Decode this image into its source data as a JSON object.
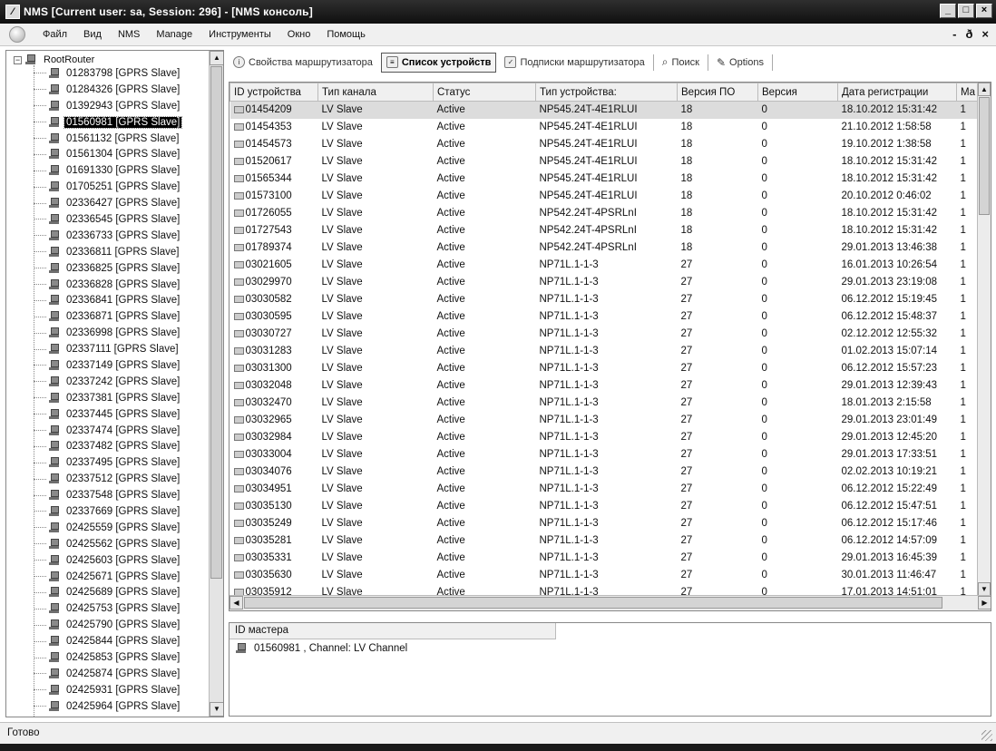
{
  "window": {
    "title": "NMS [Current user: sa, Session: 296] - [NMS консоль]",
    "app_icon": "nms-app-icon"
  },
  "menu": {
    "items": [
      "Файл",
      "Вид",
      "NMS",
      "Manage",
      "Инструменты",
      "Окно",
      "Помощь"
    ],
    "mdi_controls": [
      "-",
      "ð",
      "×"
    ]
  },
  "tree": {
    "root": "RootRouter",
    "items": [
      "01283798 [GPRS Slave]",
      "01284326 [GPRS Slave]",
      "01392943 [GPRS Slave]",
      "01560981 [GPRS Slave]",
      "01561132 [GPRS Slave]",
      "01561304 [GPRS Slave]",
      "01691330 [GPRS Slave]",
      "01705251 [GPRS Slave]",
      "02336427 [GPRS Slave]",
      "02336545 [GPRS Slave]",
      "02336733 [GPRS Slave]",
      "02336811 [GPRS Slave]",
      "02336825 [GPRS Slave]",
      "02336828 [GPRS Slave]",
      "02336841 [GPRS Slave]",
      "02336871 [GPRS Slave]",
      "02336998 [GPRS Slave]",
      "02337111 [GPRS Slave]",
      "02337149 [GPRS Slave]",
      "02337242 [GPRS Slave]",
      "02337381 [GPRS Slave]",
      "02337445 [GPRS Slave]",
      "02337474 [GPRS Slave]",
      "02337482 [GPRS Slave]",
      "02337495 [GPRS Slave]",
      "02337512 [GPRS Slave]",
      "02337548 [GPRS Slave]",
      "02337669 [GPRS Slave]",
      "02425559 [GPRS Slave]",
      "02425562 [GPRS Slave]",
      "02425603 [GPRS Slave]",
      "02425671 [GPRS Slave]",
      "02425689 [GPRS Slave]",
      "02425753 [GPRS Slave]",
      "02425790 [GPRS Slave]",
      "02425844 [GPRS Slave]",
      "02425853 [GPRS Slave]",
      "02425874 [GPRS Slave]",
      "02425931 [GPRS Slave]",
      "02425964 [GPRS Slave]"
    ],
    "selected_index": 3
  },
  "toolbar": {
    "tabs": [
      {
        "label": "Свойства маршрутизатора",
        "icon": "info-icon",
        "active": false
      },
      {
        "label": "Список устройств",
        "icon": "device-list-icon",
        "active": true
      },
      {
        "label": "Подписки маршрутизатора",
        "icon": "checkbox-icon",
        "active": false
      },
      {
        "label": "Поиск",
        "icon": "search-icon",
        "active": false
      },
      {
        "label": "Options",
        "icon": "pencil-icon",
        "active": false
      }
    ]
  },
  "grid": {
    "columns": [
      "ID устройства",
      "Тип канала",
      "Статус",
      "Тип устройства:",
      "Версия ПО",
      "Версия",
      "Дата регистрации",
      "Ma"
    ],
    "selected_row": 0,
    "rows": [
      [
        "01454209",
        "LV Slave",
        "Active",
        "NP545.24T-4E1RLUI",
        "18",
        "0",
        "18.10.2012 15:31:42",
        "1"
      ],
      [
        "01454353",
        "LV Slave",
        "Active",
        "NP545.24T-4E1RLUI",
        "18",
        "0",
        "21.10.2012 1:58:58",
        "1"
      ],
      [
        "01454573",
        "LV Slave",
        "Active",
        "NP545.24T-4E1RLUI",
        "18",
        "0",
        "19.10.2012 1:38:58",
        "1"
      ],
      [
        "01520617",
        "LV Slave",
        "Active",
        "NP545.24T-4E1RLUI",
        "18",
        "0",
        "18.10.2012 15:31:42",
        "1"
      ],
      [
        "01565344",
        "LV Slave",
        "Active",
        "NP545.24T-4E1RLUI",
        "18",
        "0",
        "18.10.2012 15:31:42",
        "1"
      ],
      [
        "01573100",
        "LV Slave",
        "Active",
        "NP545.24T-4E1RLUI",
        "18",
        "0",
        "20.10.2012 0:46:02",
        "1"
      ],
      [
        "01726055",
        "LV Slave",
        "Active",
        "NP542.24T-4PSRLnI",
        "18",
        "0",
        "18.10.2012 15:31:42",
        "1"
      ],
      [
        "01727543",
        "LV Slave",
        "Active",
        "NP542.24T-4PSRLnI",
        "18",
        "0",
        "18.10.2012 15:31:42",
        "1"
      ],
      [
        "01789374",
        "LV Slave",
        "Active",
        "NP542.24T-4PSRLnI",
        "18",
        "0",
        "29.01.2013 13:46:38",
        "1"
      ],
      [
        "03021605",
        "LV Slave",
        "Active",
        "NP71L.1-1-3",
        "27",
        "0",
        "16.01.2013 10:26:54",
        "1"
      ],
      [
        "03029970",
        "LV Slave",
        "Active",
        "NP71L.1-1-3",
        "27",
        "0",
        "29.01.2013 23:19:08",
        "1"
      ],
      [
        "03030582",
        "LV Slave",
        "Active",
        "NP71L.1-1-3",
        "27",
        "0",
        "06.12.2012 15:19:45",
        "1"
      ],
      [
        "03030595",
        "LV Slave",
        "Active",
        "NP71L.1-1-3",
        "27",
        "0",
        "06.12.2012 15:48:37",
        "1"
      ],
      [
        "03030727",
        "LV Slave",
        "Active",
        "NP71L.1-1-3",
        "27",
        "0",
        "02.12.2012 12:55:32",
        "1"
      ],
      [
        "03031283",
        "LV Slave",
        "Active",
        "NP71L.1-1-3",
        "27",
        "0",
        "01.02.2013 15:07:14",
        "1"
      ],
      [
        "03031300",
        "LV Slave",
        "Active",
        "NP71L.1-1-3",
        "27",
        "0",
        "06.12.2012 15:57:23",
        "1"
      ],
      [
        "03032048",
        "LV Slave",
        "Active",
        "NP71L.1-1-3",
        "27",
        "0",
        "29.01.2013 12:39:43",
        "1"
      ],
      [
        "03032470",
        "LV Slave",
        "Active",
        "NP71L.1-1-3",
        "27",
        "0",
        "18.01.2013 2:15:58",
        "1"
      ],
      [
        "03032965",
        "LV Slave",
        "Active",
        "NP71L.1-1-3",
        "27",
        "0",
        "29.01.2013 23:01:49",
        "1"
      ],
      [
        "03032984",
        "LV Slave",
        "Active",
        "NP71L.1-1-3",
        "27",
        "0",
        "29.01.2013 12:45:20",
        "1"
      ],
      [
        "03033004",
        "LV Slave",
        "Active",
        "NP71L.1-1-3",
        "27",
        "0",
        "29.01.2013 17:33:51",
        "1"
      ],
      [
        "03034076",
        "LV Slave",
        "Active",
        "NP71L.1-1-3",
        "27",
        "0",
        "02.02.2013 10:19:21",
        "1"
      ],
      [
        "03034951",
        "LV Slave",
        "Active",
        "NP71L.1-1-3",
        "27",
        "0",
        "06.12.2012 15:22:49",
        "1"
      ],
      [
        "03035130",
        "LV Slave",
        "Active",
        "NP71L.1-1-3",
        "27",
        "0",
        "06.12.2012 15:47:51",
        "1"
      ],
      [
        "03035249",
        "LV Slave",
        "Active",
        "NP71L.1-1-3",
        "27",
        "0",
        "06.12.2012 15:17:46",
        "1"
      ],
      [
        "03035281",
        "LV Slave",
        "Active",
        "NP71L.1-1-3",
        "27",
        "0",
        "06.12.2012 14:57:09",
        "1"
      ],
      [
        "03035331",
        "LV Slave",
        "Active",
        "NP71L.1-1-3",
        "27",
        "0",
        "29.01.2013 16:45:39",
        "1"
      ],
      [
        "03035630",
        "LV Slave",
        "Active",
        "NP71L.1-1-3",
        "27",
        "0",
        "30.01.2013 11:46:47",
        "1"
      ],
      [
        "03035912",
        "LV Slave",
        "Active",
        "NP71L.1-1-3",
        "27",
        "0",
        "17.01.2013 14:51:01",
        "1"
      ]
    ]
  },
  "detail": {
    "header": "ID мастера",
    "entry": "01560981 , Channel: LV Channel"
  },
  "status": {
    "text": "Готово"
  }
}
